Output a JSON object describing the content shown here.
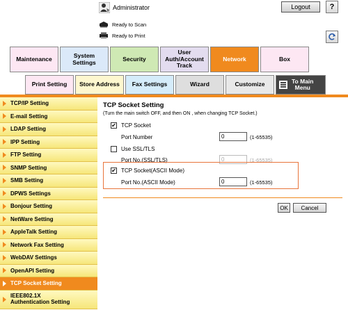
{
  "header": {
    "user_label": "Administrator",
    "logout_label": "Logout",
    "help_label": "?",
    "ready_to_scan": "Ready to Scan",
    "ready_to_print": "Ready to Print"
  },
  "tabs": [
    {
      "label": "Maintenance",
      "color": "#fde7f3"
    },
    {
      "label": "System\nSettings",
      "color": "#dbe9f9"
    },
    {
      "label": "Security",
      "color": "#cfe9b4"
    },
    {
      "label": "User\nAuth/Account\nTrack",
      "color": "#e3dcef"
    },
    {
      "label": "Network",
      "color": "#f08a1e",
      "active": true
    },
    {
      "label": "Box",
      "color": "#fde7f3"
    }
  ],
  "subtabs": [
    {
      "label": "Print Setting",
      "color": "#fde7f3"
    },
    {
      "label": "Store Address",
      "color": "#fdf7cf"
    },
    {
      "label": "Fax Settings",
      "color": "#d5ecfa"
    },
    {
      "label": "Wizard",
      "color": "#dedede"
    },
    {
      "label": "Customize",
      "color": "#e8e8e8"
    },
    {
      "label": "To Main\nMenu",
      "color": "#444444"
    }
  ],
  "sidebar": {
    "items": [
      {
        "label": "TCP/IP Setting"
      },
      {
        "label": "E-mail Setting"
      },
      {
        "label": "LDAP Setting"
      },
      {
        "label": "IPP Setting"
      },
      {
        "label": "FTP Setting"
      },
      {
        "label": "SNMP Setting"
      },
      {
        "label": "SMB Setting"
      },
      {
        "label": "DPWS Settings"
      },
      {
        "label": "Bonjour Setting"
      },
      {
        "label": "NetWare Setting"
      },
      {
        "label": "AppleTalk Setting"
      },
      {
        "label": "Network Fax Setting"
      },
      {
        "label": "WebDAV Settings"
      },
      {
        "label": "OpenAPI Setting"
      },
      {
        "label": "TCP Socket Setting",
        "active": true
      },
      {
        "label": "IEEE802.1X\nAuthentication Setting"
      }
    ]
  },
  "main": {
    "title": "TCP Socket Setting",
    "note": "(Turn the main switch OFF, and then ON , when changing TCP Socket.)",
    "tcp_socket_label": "TCP Socket",
    "tcp_socket_checked": "✔",
    "port_number_label": "Port Number",
    "port_number_value": "0",
    "port_number_range": "(1-65535)",
    "ssl_label": "Use SSL/TLS",
    "ssl_checked": "",
    "ssl_port_label": "Port No.(SSL/TLS)",
    "ssl_port_value": "0",
    "ssl_port_range": "(1-65535)",
    "ascii_label": "TCP Socket(ASCII Mode)",
    "ascii_checked": "✔",
    "ascii_port_label": "Port No.(ASCII Mode)",
    "ascii_port_value": "0",
    "ascii_port_range": "(1-65535)",
    "ok_label": "OK",
    "cancel_label": "Cancel"
  },
  "colors": {
    "accent": "#f08a1e",
    "highlight_box": "#e8743b",
    "sidebar_bg": "#f6e67a"
  }
}
